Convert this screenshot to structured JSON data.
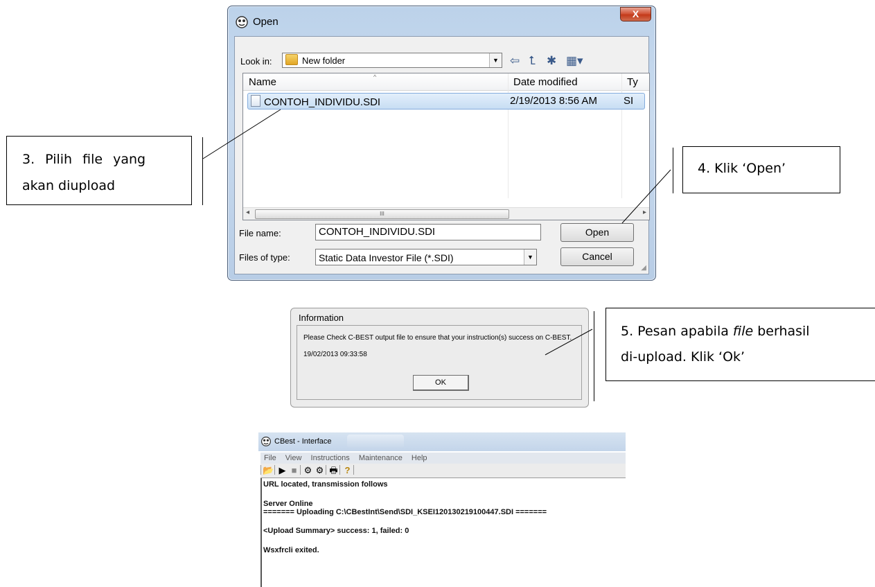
{
  "open_dialog": {
    "title": "Open",
    "close_label": "X",
    "look_in_label": "Look in:",
    "look_in_value": "New folder",
    "columns": [
      "Name",
      "Date modified",
      "Ty"
    ],
    "files": [
      {
        "name": "CONTOH_INDIVIDU.SDI",
        "date": "2/19/2013 8:56 AM",
        "type": "SI"
      }
    ],
    "scroll_thumb": "III",
    "file_name_label": "File name:",
    "file_name_value": "CONTOH_INDIVIDU.SDI",
    "files_of_type_label": "Files of type:",
    "files_of_type_value": "Static Data Investor File (*.SDI)",
    "open_button": "Open",
    "cancel_button": "Cancel"
  },
  "callouts": {
    "step3_line1": "3. Pilih file yang",
    "step3_line2": "akan diupload",
    "step4": "4. Klik ‘Open’",
    "step5_line1_pre": "5. Pesan apabila ",
    "step5_line1_em": "file",
    "step5_line1_post": " berhasil",
    "step5_line2": "di-upload. Klik ‘Ok’"
  },
  "info_dialog": {
    "title": "Information",
    "message": "Please Check C-BEST output file to ensure that your instruction(s) success on C-BEST.",
    "timestamp": "19/02/2013 09:33:58",
    "ok_button": "OK"
  },
  "cbest_window": {
    "title": "CBest - Interface",
    "menu": [
      "File",
      "View",
      "Instructions",
      "Maintenance",
      "Help"
    ],
    "log_lines": [
      "URL located, transmission follows",
      "Server Online",
      "======= Uploading C:\\CBestInt\\Send\\SDI_KSEI120130219100447.SDI =======",
      "<Upload Summary> success: 1, failed: 0",
      "Wsxfrcli exited."
    ]
  },
  "colors": {
    "dialog_frame": "#bcd2ea",
    "close_button": "#c4391a",
    "selection": "#c7ddf3"
  }
}
